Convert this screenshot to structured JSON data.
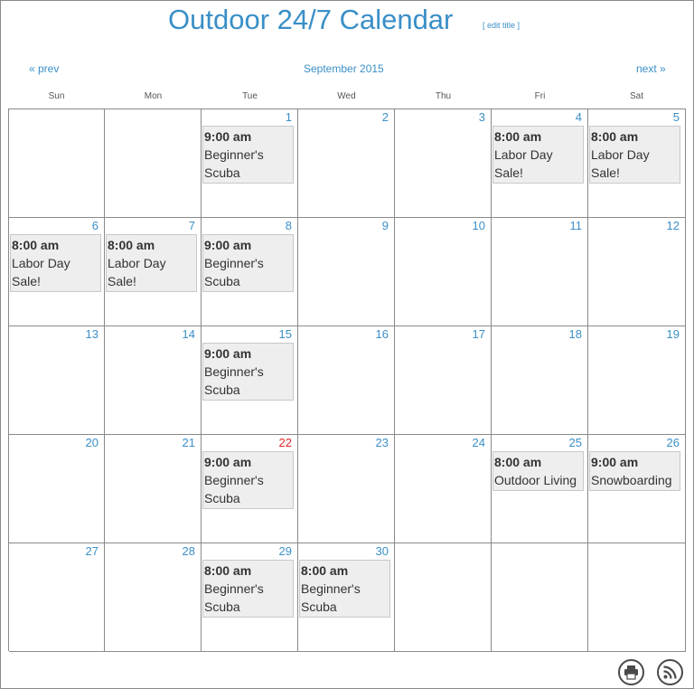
{
  "header": {
    "title": "Outdoor 24/7 Calendar",
    "edit_title": "[ edit title ]",
    "prev": "« prev",
    "next": "next »",
    "month": "September 2015"
  },
  "weekdays": [
    "Sun",
    "Mon",
    "Tue",
    "Wed",
    "Thu",
    "Fri",
    "Sat"
  ],
  "colors": {
    "accent": "#3a8fc7",
    "today": "#e0262a",
    "event_bg": "#eeeeee"
  },
  "weeks": [
    [
      {
        "day": "",
        "events": []
      },
      {
        "day": "",
        "events": []
      },
      {
        "day": "1",
        "events": [
          {
            "time": "9:00 am",
            "name": "Beginner's Scuba"
          }
        ]
      },
      {
        "day": "2",
        "events": []
      },
      {
        "day": "3",
        "events": []
      },
      {
        "day": "4",
        "events": [
          {
            "time": "8:00 am",
            "name": "Labor Day Sale!"
          }
        ]
      },
      {
        "day": "5",
        "events": [
          {
            "time": "8:00 am",
            "name": "Labor Day Sale!"
          }
        ]
      }
    ],
    [
      {
        "day": "6",
        "events": [
          {
            "time": "8:00 am",
            "name": "Labor Day Sale!"
          }
        ]
      },
      {
        "day": "7",
        "events": [
          {
            "time": "8:00 am",
            "name": "Labor Day Sale!"
          }
        ]
      },
      {
        "day": "8",
        "events": [
          {
            "time": "9:00 am",
            "name": "Beginner's Scuba"
          }
        ]
      },
      {
        "day": "9",
        "events": []
      },
      {
        "day": "10",
        "events": []
      },
      {
        "day": "11",
        "events": []
      },
      {
        "day": "12",
        "events": []
      }
    ],
    [
      {
        "day": "13",
        "events": []
      },
      {
        "day": "14",
        "events": []
      },
      {
        "day": "15",
        "events": [
          {
            "time": "9:00 am",
            "name": "Beginner's Scuba"
          }
        ]
      },
      {
        "day": "16",
        "events": []
      },
      {
        "day": "17",
        "events": []
      },
      {
        "day": "18",
        "events": []
      },
      {
        "day": "19",
        "events": []
      }
    ],
    [
      {
        "day": "20",
        "events": []
      },
      {
        "day": "21",
        "events": []
      },
      {
        "day": "22",
        "today": true,
        "events": [
          {
            "time": "9:00 am",
            "name": "Beginner's Scuba"
          }
        ]
      },
      {
        "day": "23",
        "events": []
      },
      {
        "day": "24",
        "events": []
      },
      {
        "day": "25",
        "events": [
          {
            "time": "8:00 am",
            "name": "Outdoor Living"
          }
        ]
      },
      {
        "day": "26",
        "events": [
          {
            "time": "9:00 am",
            "name": "Snowboarding"
          }
        ]
      }
    ],
    [
      {
        "day": "27",
        "events": []
      },
      {
        "day": "28",
        "events": []
      },
      {
        "day": "29",
        "events": [
          {
            "time": "8:00 am",
            "name": "Beginner's Scuba"
          }
        ]
      },
      {
        "day": "30",
        "events": [
          {
            "time": "8:00 am",
            "name": "Beginner's Scuba"
          }
        ]
      },
      {
        "day": "",
        "events": []
      },
      {
        "day": "",
        "events": []
      },
      {
        "day": "",
        "events": []
      }
    ]
  ],
  "footer": {
    "print_icon": "printer-icon",
    "rss_icon": "rss-icon"
  }
}
